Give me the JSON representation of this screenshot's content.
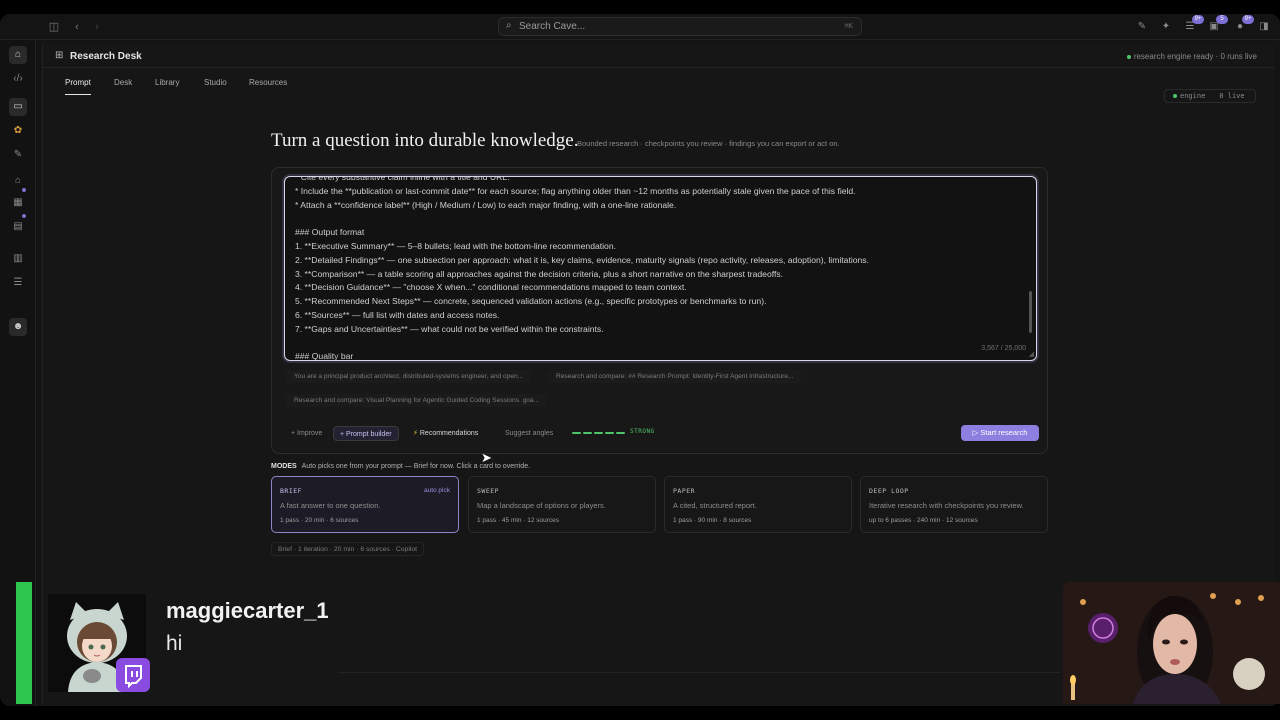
{
  "titlebar": {
    "search_placeholder": "Search Cave...",
    "search_shortcut": "⌘K",
    "badges": [
      "9+",
      "5",
      "9+"
    ]
  },
  "workspace": {
    "title": "Research Desk",
    "status": "research engine ready · 0 runs live",
    "engine_label": "engine",
    "engine_live": "0 live",
    "tabs": [
      {
        "label": "Prompt",
        "active": true
      },
      {
        "label": "Desk",
        "active": false
      },
      {
        "label": "Library",
        "active": false
      },
      {
        "label": "Studio",
        "active": false
      },
      {
        "label": "Resources",
        "active": false
      }
    ]
  },
  "heading": {
    "title": "Turn a question into durable knowledge.",
    "subtitle": "Bounded research · checkpoints you review · findings you can export or act on."
  },
  "editor": {
    "lines": [
      "* Cite every substantive claim inline with a title and URL.",
      "* Include the **publication or last-commit date** for each source; flag anything older than ~12 months as potentially stale given the pace of this field.",
      "* Attach a **confidence label** (High / Medium / Low) to each major finding, with a one-line rationale.",
      "",
      "### Output format",
      "1. **Executive Summary** — 5–8 bullets; lead with the bottom-line recommendation.",
      "2. **Detailed Findings** — one subsection per approach: what it is, key claims, evidence, maturity signals (repo activity, releases, adoption), limitations.",
      "3. **Comparison** — a table scoring all approaches against the decision criteria, plus a short narrative on the sharpest tradeoffs.",
      "4. **Decision Guidance** — \"choose X when...\" conditional recommendations mapped to team context.",
      "5. **Recommended Next Steps** — concrete, sequenced validation actions (e.g., specific prototypes or benchmarks to run).",
      "6. **Sources** — full list with dates and access notes.",
      "7. **Gaps and Uncertainties** — what could not be verified within the constraints.",
      "",
      "### Quality bar"
    ],
    "char_count": "3,567 / 25,000"
  },
  "recent_prompts": [
    "You are a principal product architect, distributed-systems engineer, and open...",
    "Research and compare: ## Research Prompt: Identity-First Agent Infrastructure...",
    "Research and compare: Visual Planning for Agentic Guided Coding Sessions. goa..."
  ],
  "toolbar": {
    "improve": "+ Improve",
    "prompt_builder": "+ Prompt builder",
    "recommendations": "Recommendations",
    "suggest_angles": "Suggest angles",
    "strength_label": "STRONG",
    "strength_level": 5,
    "start": "Start research"
  },
  "modes": {
    "label": "MODES",
    "hint": "Auto picks one from your prompt — Brief for now. Click a card to override.",
    "items": [
      {
        "title": "BRIEF",
        "badge": "auto pick",
        "desc": "A fast answer to one question.",
        "meta": "1 pass · 20 min · 6 sources",
        "selected": true
      },
      {
        "title": "SWEEP",
        "badge": "",
        "desc": "Map a landscape of options or players.",
        "meta": "1 pass · 45 min · 12 sources",
        "selected": false
      },
      {
        "title": "PAPER",
        "badge": "",
        "desc": "A cited, structured report.",
        "meta": "1 pass · 90 min · 8 sources",
        "selected": false
      },
      {
        "title": "DEEP LOOP",
        "badge": "",
        "desc": "Iterative research with checkpoints you review.",
        "meta": "up to 6 passes · 240 min · 12 sources",
        "selected": false
      }
    ],
    "summary": "Brief · 1 iteration · 20 min · 6 sources · Copilot"
  },
  "stream_overlay": {
    "username": "maggiecarter_1",
    "message": "hi"
  },
  "colors": {
    "accent": "#8c7fe0",
    "success": "#4ec46a",
    "twitch": "#8a4be0",
    "overlay_bar": "#2fc64f"
  },
  "icons": [
    "sidebar-toggle-icon",
    "back-icon",
    "forward-icon",
    "search-icon",
    "compose-icon",
    "sparkle-icon",
    "inbox-icon",
    "bell-icon",
    "alert-icon",
    "panel-icon",
    "home-icon",
    "code-icon",
    "folder-icon",
    "calendar-icon",
    "edit-icon",
    "box-icon",
    "grid-icon",
    "doc-icon",
    "trash-icon",
    "list-icon",
    "robot-icon",
    "bolt-icon",
    "play-icon"
  ]
}
